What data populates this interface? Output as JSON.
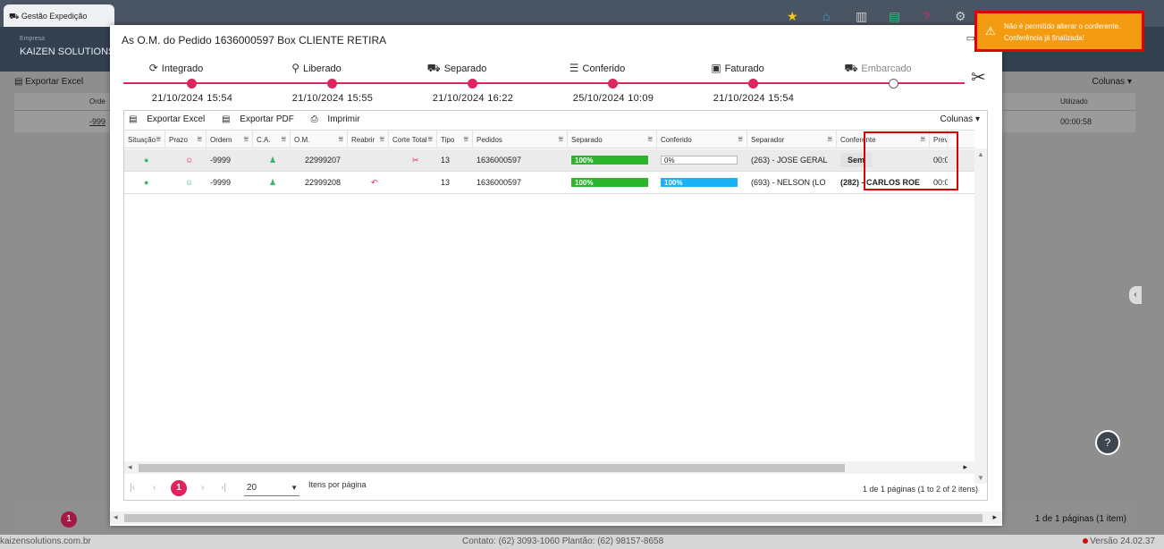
{
  "app": {
    "tab_label": "Gestão Expedição",
    "company_label": "Empresa",
    "company_name": "KAIZEN SOLUTIONS"
  },
  "background_grid": {
    "export_excel": "Exportar Excel",
    "columns": "Colunas",
    "header_order": "Orde",
    "header_utilizado": "Utilizado",
    "row_order": "-999",
    "row_utilizado": "00:00:58",
    "page_number": "1",
    "footer_info": "1 de 1 páginas (1 item)"
  },
  "modal": {
    "title": "As O.M. do Pedido 1636000597 Box CLIENTE RETIRA",
    "steps": [
      {
        "label": "Integrado",
        "date": "21/10/2024 15:54",
        "icon": "sync-icon",
        "glyph": "⟳",
        "done": true
      },
      {
        "label": "Liberado",
        "date": "21/10/2024 15:55",
        "icon": "user-search-icon",
        "glyph": "⚲",
        "done": true
      },
      {
        "label": "Separado",
        "date": "21/10/2024 16:22",
        "icon": "hand-truck-icon",
        "glyph": "⛟",
        "done": true
      },
      {
        "label": "Conferido",
        "date": "25/10/2024 10:09",
        "icon": "checklist-icon",
        "glyph": "☰",
        "done": true
      },
      {
        "label": "Faturado",
        "date": "21/10/2024 15:54",
        "icon": "money-icon",
        "glyph": "▣",
        "done": true
      },
      {
        "label": "Embarcado",
        "date": "",
        "icon": "truck-icon",
        "glyph": "⛟",
        "done": false
      }
    ],
    "toolbar": {
      "export_excel": "Exportar Excel",
      "export_pdf": "Exportar PDF",
      "print": "Imprimir",
      "columns": "Colunas"
    },
    "columns": [
      "Situação",
      "Prazo",
      "Ordem",
      "C.A.",
      "O.M.",
      "Reabrir",
      "Corte Total",
      "Tipo",
      "Pedidos",
      "Separado",
      "Conferido",
      "Separador",
      "Conferente",
      "Prev"
    ],
    "rows": [
      {
        "ordem": "-9999",
        "om": "22999207",
        "tipo": "13",
        "pedidos": "1636000597",
        "separado": "100%",
        "conferido": "0%",
        "separador": "(263) - JOSE GERAL",
        "conferente": "Sem",
        "prev": "00:0"
      },
      {
        "ordem": "-9999",
        "om": "22999208",
        "tipo": "13",
        "pedidos": "1636000597",
        "separado": "100%",
        "conferido": "100%",
        "separador": "(693) - NELSON (LO",
        "conferente": "(282) - CARLOS ROE",
        "prev": "00:0"
      }
    ],
    "pager": {
      "current_page": "1",
      "page_size": "20",
      "page_size_label": "Itens por página",
      "info": "1 de 1 páginas (1 to 2 of 2 itens)"
    }
  },
  "toast": {
    "line1": "Não é permitido alterar o conferente.",
    "line2": "Conferência já finalizada!"
  },
  "statusbar": {
    "site": "kaizensolutions.com.br",
    "contact": "Contato: (62) 3093-1060   Plantão: (62) 98157-8658",
    "version": "Versão 24.02.37"
  },
  "colors": {
    "accent": "#e0245e",
    "toast_bg": "#f39c12",
    "highlight": "#e00000",
    "progress_green": "#2db52d",
    "progress_blue": "#1ab2f5"
  }
}
